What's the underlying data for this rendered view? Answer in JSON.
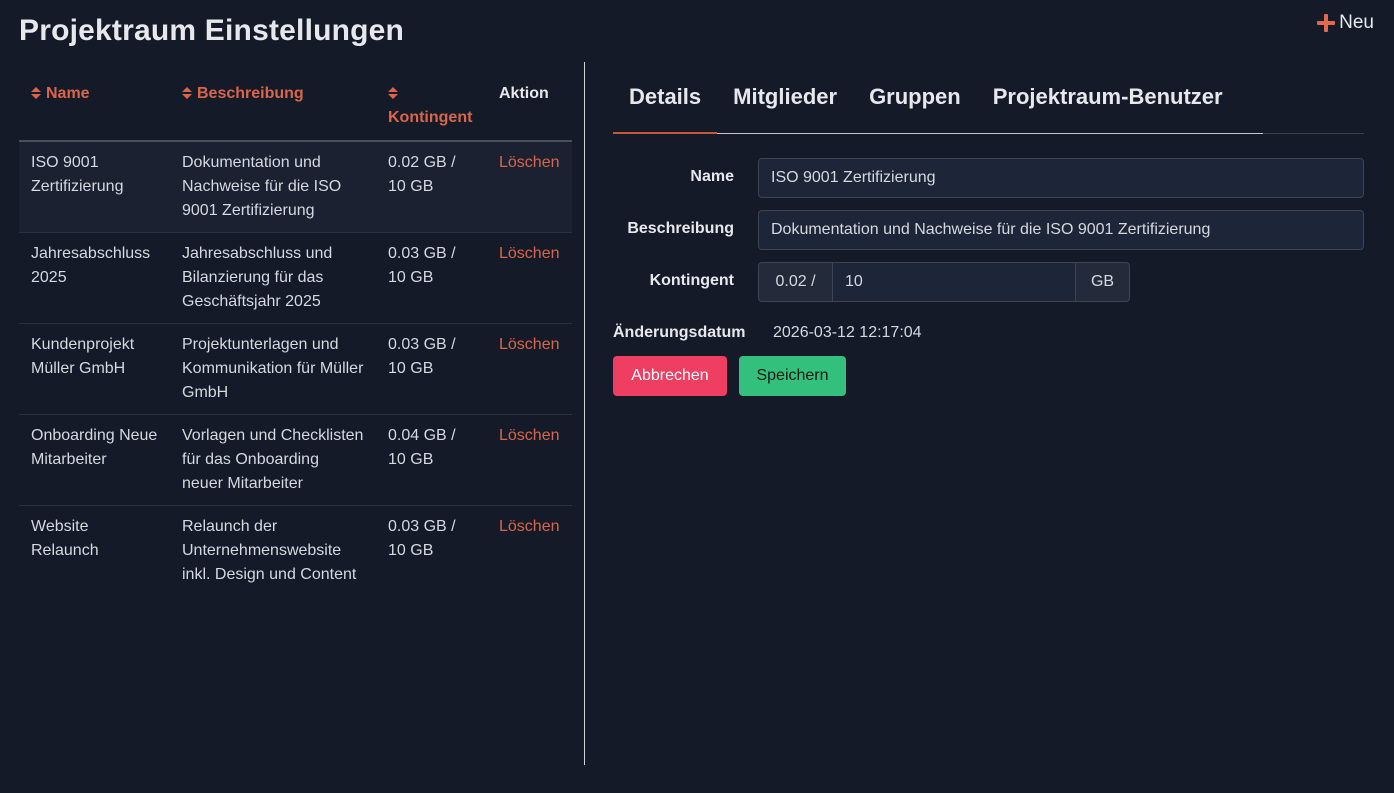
{
  "header": {
    "title": "Projektraum Einstellungen",
    "new_label": "Neu"
  },
  "colors": {
    "accent": "#d9664a",
    "background": "#141a28",
    "cancel": "#ee3e62",
    "save": "#33c07d"
  },
  "table": {
    "columns": {
      "name": "Name",
      "description": "Beschreibung",
      "quota": "Kontingent",
      "action": "Aktion"
    },
    "rows": [
      {
        "name": "ISO 9001 Zertifizierung",
        "description": "Dokumentation und Nachweise für die ISO 9001 Zertifizierung",
        "quota": "0.02 GB / 10 GB",
        "action": "Löschen"
      },
      {
        "name": "Jahresabschluss 2025",
        "description": "Jahresabschluss und Bilanzierung für das Geschäftsjahr 2025",
        "quota": "0.03 GB / 10 GB",
        "action": "Löschen"
      },
      {
        "name": "Kundenprojekt Müller GmbH",
        "description": "Projektunterlagen und Kommunikation für Müller GmbH",
        "quota": "0.03 GB / 10 GB",
        "action": "Löschen"
      },
      {
        "name": "Onboarding Neue Mitarbeiter",
        "description": "Vorlagen und Checklisten für das Onboarding neuer Mitarbeiter",
        "quota": "0.04 GB / 10 GB",
        "action": "Löschen"
      },
      {
        "name": "Website Relaunch",
        "description": "Relaunch der Unternehmenswebsite inkl. Design und Content",
        "quota": "0.03 GB / 10 GB",
        "action": "Löschen"
      }
    ]
  },
  "tabs": [
    {
      "label": "Details",
      "active": true
    },
    {
      "label": "Mitglieder",
      "active": false
    },
    {
      "label": "Gruppen",
      "active": false
    },
    {
      "label": "Projektraum-Benutzer",
      "active": false
    }
  ],
  "form": {
    "name_label": "Name",
    "name_value": "ISO 9001 Zertifizierung",
    "description_label": "Beschreibung",
    "description_value": "Dokumentation und Nachweise für die ISO 9001 Zertifizierung",
    "quota_label": "Kontingent",
    "quota_used": "0.02 /",
    "quota_value": "10",
    "quota_unit": "GB",
    "modified_label": "Änderungsdatum",
    "modified_value": "2026-03-12 12:17:04",
    "cancel_label": "Abbrechen",
    "save_label": "Speichern"
  }
}
